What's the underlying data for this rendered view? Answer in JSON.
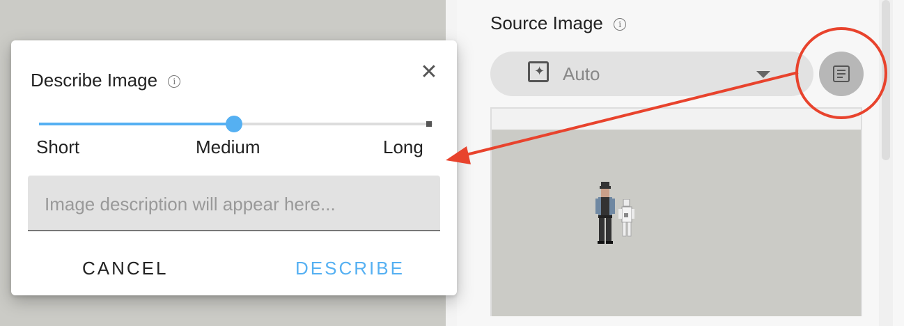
{
  "panel": {
    "title": "Source Image",
    "select": {
      "value": "Auto"
    },
    "describe_button_icon": "document-icon"
  },
  "dialog": {
    "title": "Describe Image",
    "slider": {
      "labels": [
        "Short",
        "Medium",
        "Long"
      ],
      "selected": "Medium",
      "position": 0.5
    },
    "description": {
      "value": "",
      "placeholder": "Image description will appear here..."
    },
    "buttons": {
      "cancel": "CANCEL",
      "describe": "DESCRIBE"
    }
  },
  "colors": {
    "accent": "#55b0f2",
    "annotation": "#e8432d"
  }
}
